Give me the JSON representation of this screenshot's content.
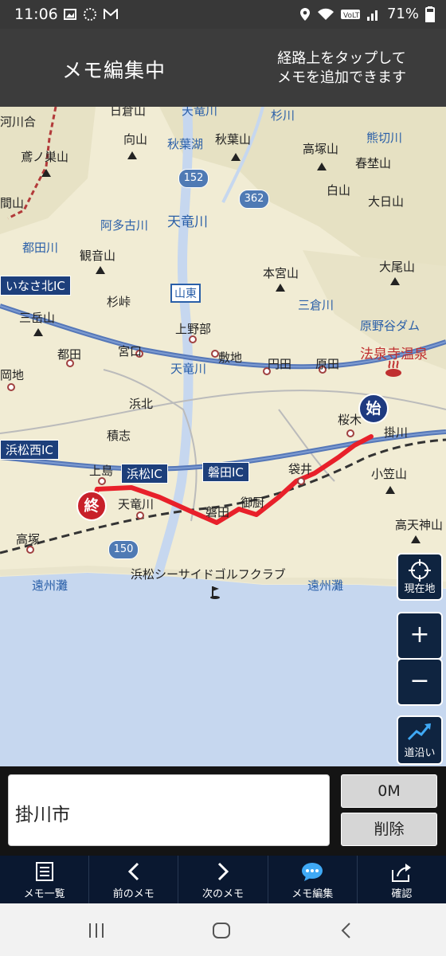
{
  "status": {
    "time": "11:06",
    "battery": "71%",
    "left_icons": [
      "image-icon",
      "spinner-icon",
      "gmail-icon"
    ],
    "right_icons": [
      "location-icon",
      "wifi-icon",
      "volte-icon",
      "signal-icon",
      "battery-icon"
    ]
  },
  "header": {
    "title": "メモ編集中",
    "hint_line1": "経路上をタップして",
    "hint_line2": "メモを追加できます"
  },
  "map": {
    "places": {
      "kawaai": "河川合",
      "hinode": "日倉山",
      "tenryugawa_top": "天竜川",
      "sugikawa": "杉川",
      "unokisu": "鳶ノ巣山",
      "mukai": "向山",
      "akiha_lake": "秋葉湖",
      "akiha_mt": "秋葉山",
      "takatsuka_mt": "高塚山",
      "kumakiri": "熊切川",
      "harunoyama": "春埜山",
      "shiro": "白山",
      "ohi": "大日山",
      "ama": "間山",
      "atago": "阿多古川",
      "tenryu_mid": "天竜川",
      "tsuda": "都田川",
      "kannon": "観音山",
      "motomiya": "本宮山",
      "oo": "大尾山",
      "sugi": "杉峠",
      "miyakura": "三倉川",
      "haranoya": "原野谷ダム",
      "sangaku": "三岳山",
      "kamino": "上野部",
      "hosenji": "法泉寺温泉",
      "tsuda_town": "都田",
      "miyaguchi": "宮口",
      "shikiji": "敷地",
      "enden": "円田",
      "hara": "原田",
      "tenryu_low": "天竜川",
      "okachi": "岡地",
      "hamakita": "浜北",
      "sakuragi": "桜木",
      "kakegawa": "掛川",
      "sekishi": "積志",
      "kamijima": "上島",
      "fukuroi": "袋井",
      "ogasa": "小笠山",
      "tenryugawa_st": "天竜川",
      "iwata": "磐田",
      "mikuriya": "御厨",
      "takatsuka": "高塚",
      "takaten": "高天神山",
      "enshunada_w": "遠州灘",
      "golf": "浜松シーサイドゴルフクラブ",
      "enshunada_e": "遠州灘",
      "sanen": "山東"
    },
    "ic_labels": {
      "inasa": "いなさ北IC",
      "hamamatsunishi": "浜松西IC",
      "hamamatsu": "浜松IC",
      "iwata": "磐田IC"
    },
    "route_shields": [
      "152",
      "362",
      "150"
    ],
    "pin_start": "始",
    "pin_end": "終",
    "colors": {
      "route": "#e8202a",
      "pin_start": "#1e3a80",
      "pin_end": "#c8202a",
      "expressway": "#5577b8",
      "sea": "#c6d7ef"
    }
  },
  "controls": {
    "current_location": "現在地",
    "zoom_in": "+",
    "zoom_out": "−",
    "along_road": "道沿い"
  },
  "edit": {
    "memo_value": "掛川市",
    "distance_button": "0M",
    "delete_button": "削除"
  },
  "toolbar": [
    {
      "label": "メモ一覧",
      "icon": "list-icon"
    },
    {
      "label": "前のメモ",
      "icon": "chevron-left-icon"
    },
    {
      "label": "次のメモ",
      "icon": "chevron-right-icon"
    },
    {
      "label": "メモ編集",
      "icon": "chat-bubble-icon"
    },
    {
      "label": "確認",
      "icon": "share-icon"
    }
  ]
}
